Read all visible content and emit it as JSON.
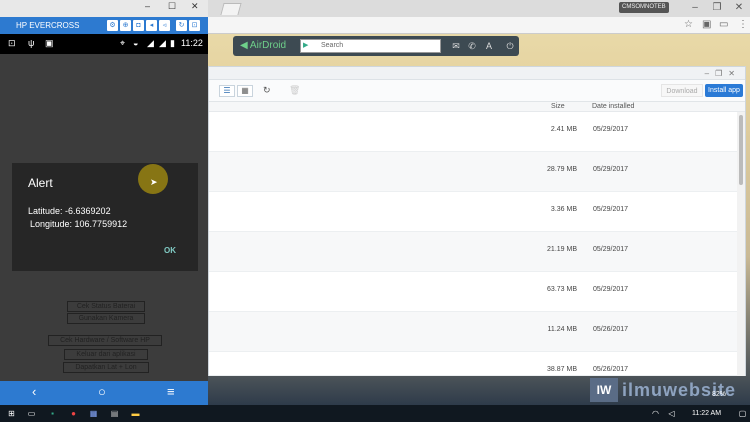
{
  "phone": {
    "window_controls": [
      "–",
      "☐",
      "✕"
    ],
    "device_name": "HP EVERCROSS",
    "toolbar_icons": [
      "⚙",
      "⊕",
      "◘",
      "◂",
      "◃",
      "↻",
      "⊡"
    ],
    "status": {
      "time": "11:22"
    },
    "background_texts": [
      "Cek Status Baterai",
      "Gunakan Kamera",
      "Cek Hardware / Software HP",
      "Keluar dari aplikasi",
      "Dapatkan Lat + Lon"
    ],
    "dialog": {
      "title": "Alert",
      "latitude": "Latitude: -6.6369202",
      "longitude": "Longitude: 106.7759912",
      "ok": "OK"
    }
  },
  "browser": {
    "window_controls": [
      "–",
      "❐",
      "✕"
    ],
    "search_placeholder": "Search",
    "logo": "AirDroid"
  },
  "panel": {
    "buttons": {
      "download": "Download",
      "install": "Install app"
    },
    "columns": {
      "size": "Size",
      "date": "Date installed"
    },
    "rows": [
      {
        "size": "2.41 MB",
        "date": "05/29/2017"
      },
      {
        "size": "28.79 MB",
        "date": "05/29/2017"
      },
      {
        "size": "3.36 MB",
        "date": "05/29/2017"
      },
      {
        "size": "21.19 MB",
        "date": "05/29/2017"
      },
      {
        "size": "63.73 MB",
        "date": "05/29/2017"
      },
      {
        "size": "11.24 MB",
        "date": "05/26/2017"
      },
      {
        "size": "38.87 MB",
        "date": "05/26/2017"
      }
    ]
  },
  "watermark": {
    "box": "IW",
    "text": "ilmuwebsite"
  },
  "taskbar": {
    "time": "11:22 AM",
    "battery": "82%"
  }
}
